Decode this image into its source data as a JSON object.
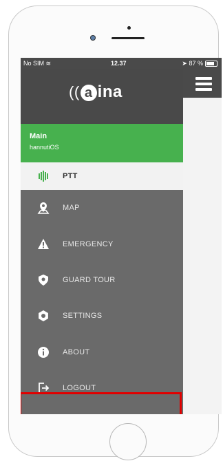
{
  "status_bar": {
    "carrier": "No SIM",
    "time": "12.37",
    "battery": "87 %"
  },
  "app": {
    "logo_text": "ina"
  },
  "profile": {
    "name": "Main",
    "user": "hannutiOS"
  },
  "menu": {
    "items": [
      {
        "label": "PTT",
        "icon": "ptt-icon"
      },
      {
        "label": "MAP",
        "icon": "map-pin-icon"
      },
      {
        "label": "EMERGENCY",
        "icon": "warning-icon"
      },
      {
        "label": "GUARD TOUR",
        "icon": "shield-icon"
      },
      {
        "label": "SETTINGS",
        "icon": "gear-icon"
      },
      {
        "label": "ABOUT",
        "icon": "info-icon"
      },
      {
        "label": "LOGOUT",
        "icon": "logout-icon"
      }
    ]
  },
  "colors": {
    "accent_green": "#47b14e",
    "drawer_bg": "#6a6a6a",
    "header_bg": "#494949",
    "highlight": "#e10000"
  }
}
